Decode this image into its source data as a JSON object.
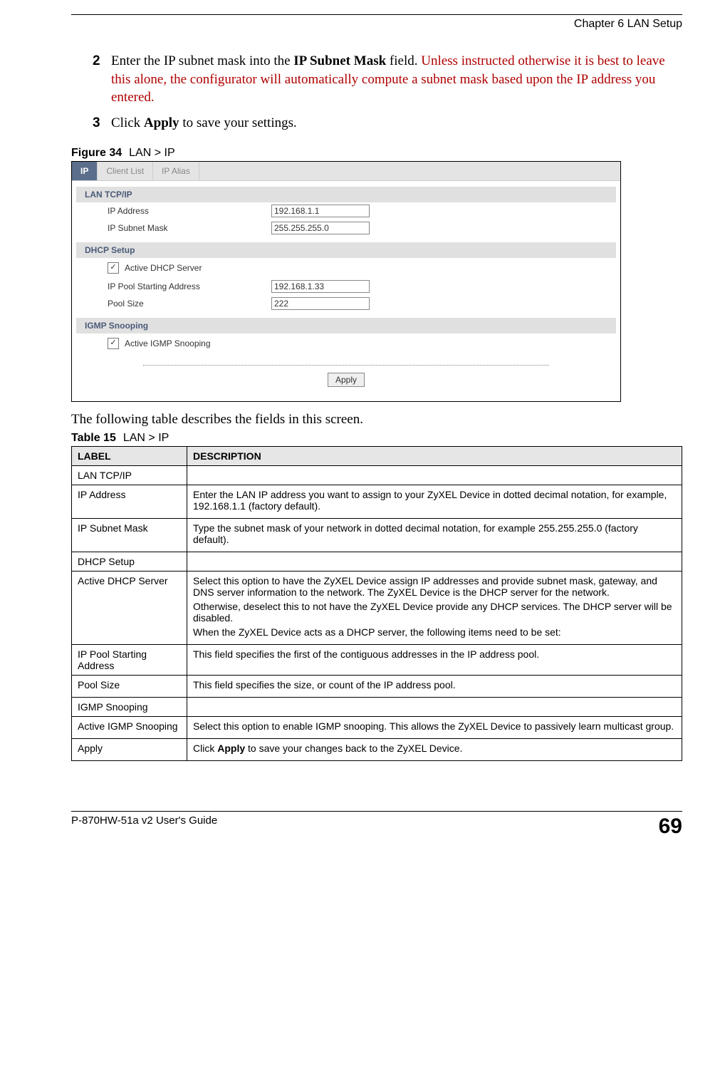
{
  "chapter_header": "Chapter 6 LAN Setup",
  "steps": [
    {
      "num": "2",
      "pre": "Enter the IP subnet mask into the ",
      "bold": "IP Subnet Mask",
      "mid": " field. ",
      "warn": "Unless instructed otherwise it is best to leave this alone, the configurator will automatically compute a subnet mask based upon the IP address you entered."
    },
    {
      "num": "3",
      "pre": "Click ",
      "bold": "Apply",
      "mid": " to save your settings.",
      "warn": ""
    }
  ],
  "figure": {
    "num": "Figure 34",
    "title": "LAN > IP"
  },
  "screenshot": {
    "tabs": [
      "IP",
      "Client List",
      "IP Alias"
    ],
    "active_tab": 0,
    "sections": {
      "lan": {
        "title": "LAN TCP/IP",
        "ip_address_label": "IP Address",
        "ip_address_value": "192.168.1.1",
        "subnet_label": "IP Subnet Mask",
        "subnet_value": "255.255.255.0"
      },
      "dhcp": {
        "title": "DHCP Setup",
        "active_label": "Active DHCP Server",
        "active_checked": true,
        "pool_start_label": "IP Pool Starting Address",
        "pool_start_value": "192.168.1.33",
        "pool_size_label": "Pool Size",
        "pool_size_value": "222"
      },
      "igmp": {
        "title": "IGMP Snooping",
        "active_label": "Active IGMP Snooping",
        "active_checked": true
      }
    },
    "apply_label": "Apply"
  },
  "post_figure_text": "The following table describes the fields in this screen.",
  "table_caption": {
    "num": "Table 15",
    "title": "LAN > IP"
  },
  "table": {
    "head_label": "LABEL",
    "head_desc": "DESCRIPTION",
    "rows": [
      {
        "label": "LAN TCP/IP",
        "desc": [
          ""
        ]
      },
      {
        "label": "IP Address",
        "desc": [
          "Enter the LAN IP address you want to assign to your ZyXEL Device in dotted decimal notation, for example, 192.168.1.1 (factory default)."
        ]
      },
      {
        "label": "IP Subnet Mask",
        "desc": [
          "Type the subnet mask of your network in dotted decimal notation, for example 255.255.255.0 (factory default)."
        ]
      },
      {
        "label": "DHCP Setup",
        "desc": [
          ""
        ]
      },
      {
        "label": "Active DHCP Server",
        "desc": [
          "Select this option to have the ZyXEL Device assign IP addresses and provide subnet mask, gateway, and DNS server information to the network. The ZyXEL Device is the DHCP server for the network.",
          "Otherwise, deselect this to not have the ZyXEL Device provide any DHCP services. The DHCP server will be disabled.",
          "When the ZyXEL Device acts as a DHCP server, the following items need to be set:"
        ]
      },
      {
        "label": "IP Pool Starting Address",
        "desc": [
          "This field specifies the first of the contiguous addresses in the IP address pool."
        ]
      },
      {
        "label": "Pool Size",
        "desc": [
          "This field specifies the size, or count of the IP address pool."
        ]
      },
      {
        "label": "IGMP Snooping",
        "desc": [
          ""
        ]
      },
      {
        "label": "Active IGMP Snooping",
        "desc": [
          "Select this option to enable IGMP snooping. This allows the ZyXEL Device to passively learn multicast group."
        ]
      },
      {
        "label": "Apply",
        "desc_pre": "Click ",
        "desc_bold": "Apply",
        "desc_post": " to save your changes back to the ZyXEL Device."
      }
    ]
  },
  "footer": {
    "guide": "P-870HW-51a v2 User's Guide",
    "page": "69"
  }
}
